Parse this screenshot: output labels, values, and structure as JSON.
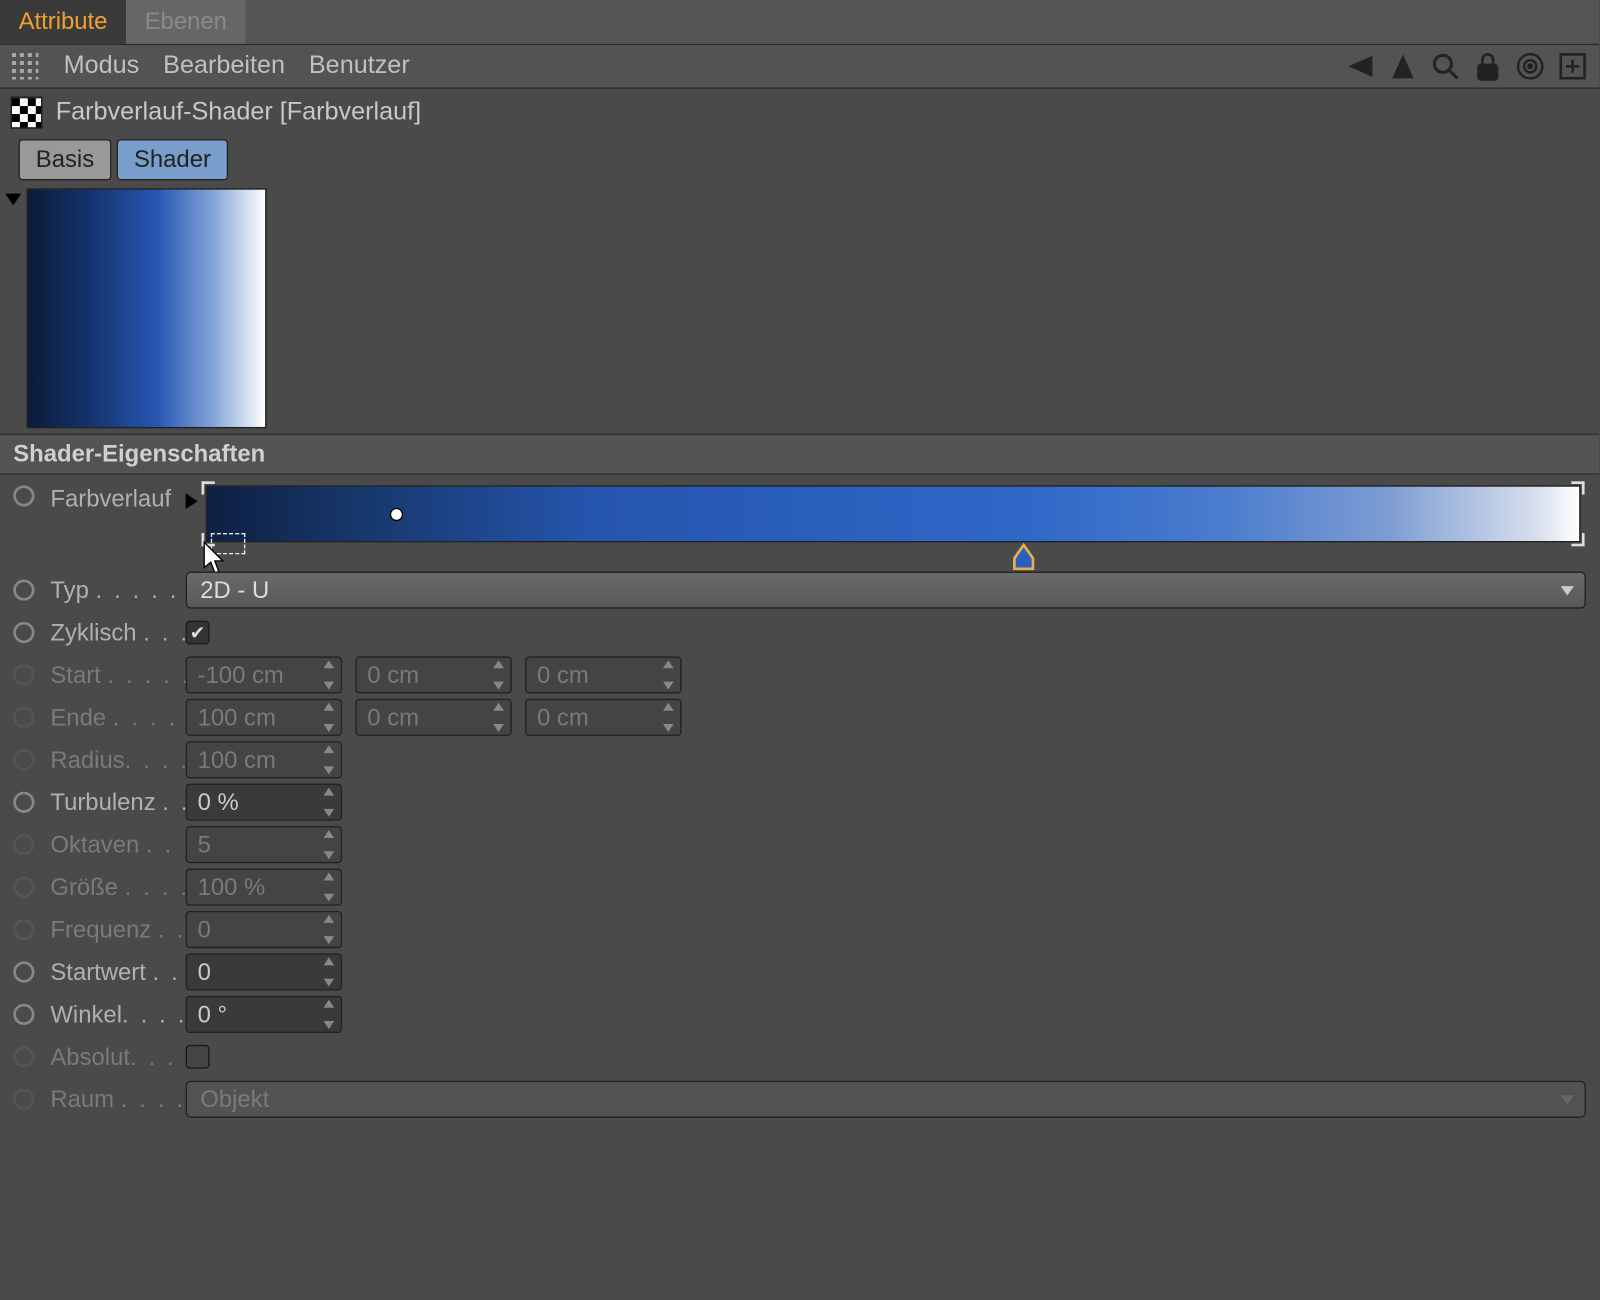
{
  "topTabs": {
    "active": "Attribute",
    "inactive": "Ebenen"
  },
  "menubar": {
    "items": [
      "Modus",
      "Bearbeiten",
      "Benutzer"
    ]
  },
  "header": {
    "title": "Farbverlauf-Shader [Farbverlauf]"
  },
  "subTabs": {
    "basis": "Basis",
    "shader": "Shader"
  },
  "section": {
    "title": "Shader-Eigenschaften"
  },
  "props": {
    "farbverlauf": {
      "label": "Farbverlauf"
    },
    "typ": {
      "label": "Typ",
      "value": "2D - U"
    },
    "zyklisch": {
      "label": "Zyklisch"
    },
    "start": {
      "label": "Start",
      "v1": "-100 cm",
      "v2": "0 cm",
      "v3": "0 cm"
    },
    "ende": {
      "label": "Ende",
      "v1": "100 cm",
      "v2": "0 cm",
      "v3": "0 cm"
    },
    "radius": {
      "label": "Radius",
      "value": "100 cm"
    },
    "turbulenz": {
      "label": "Turbulenz",
      "value": "0 %"
    },
    "oktaven": {
      "label": "Oktaven",
      "value": "5"
    },
    "groesse": {
      "label": "Größe",
      "value": "100 %"
    },
    "frequenz": {
      "label": "Frequenz",
      "value": "0"
    },
    "startwert": {
      "label": "Startwert",
      "value": "0"
    },
    "winkel": {
      "label": "Winkel",
      "value": "0 °"
    },
    "absolut": {
      "label": "Absolut"
    },
    "raum": {
      "label": "Raum",
      "value": "Objekt"
    }
  },
  "gradient": {
    "midpoint_pct": 13.8,
    "knot_pct": 59.5
  }
}
